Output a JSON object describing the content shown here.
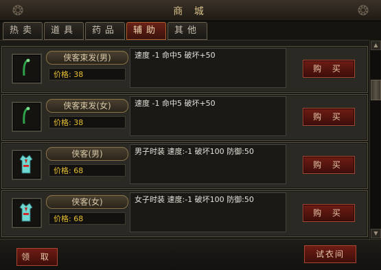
{
  "window": {
    "title": "商 城",
    "close_label": "×"
  },
  "tabs": [
    {
      "label": "热卖",
      "active": false
    },
    {
      "label": "道具",
      "active": false
    },
    {
      "label": "药品",
      "active": false
    },
    {
      "label": "辅助",
      "active": true
    },
    {
      "label": "其他",
      "active": false
    }
  ],
  "items": [
    {
      "name": "侠客束发(男)",
      "price": "价格: 38",
      "desc": "速度 -1 命中5 破坏+50",
      "buy_label": "购 买",
      "icon": "hairpin-icon"
    },
    {
      "name": "侠客束发(女)",
      "price": "价格: 38",
      "desc": "速度 -1 命中5 破坏+50",
      "buy_label": "购 买",
      "icon": "hairpin-icon"
    },
    {
      "name": "侠客(男)",
      "price": "价格: 68",
      "desc": "男子时装 速度:-1 破坏100 防御:50",
      "buy_label": "购 买",
      "icon": "robe-icon"
    },
    {
      "name": "侠客(女)",
      "price": "价格: 68",
      "desc": "女子时装 速度:-1 破坏100 防御:50",
      "buy_label": "购 买",
      "icon": "robe-icon"
    }
  ],
  "bottom": {
    "claim_label": "领 取",
    "tryon_label": "试衣间"
  },
  "colors": {
    "accent_red": "#6e1c14",
    "price_yellow": "#e8c030",
    "text_light": "#e6e2da"
  }
}
